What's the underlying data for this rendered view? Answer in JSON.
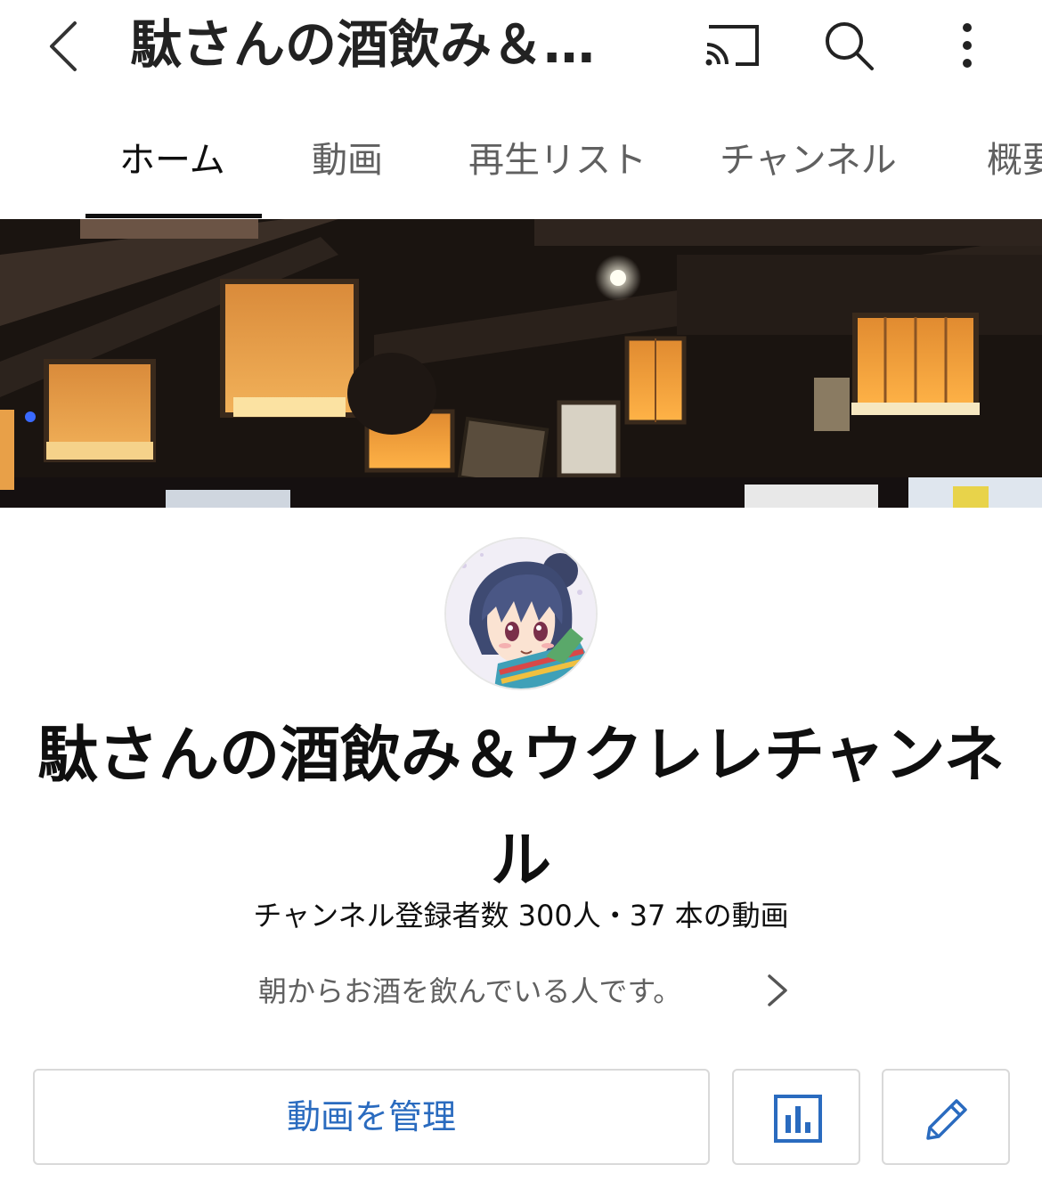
{
  "header": {
    "title": "駄さんの酒飲み＆…",
    "back_icon": "chevron-left-icon",
    "cast_icon": "cast-icon",
    "search_icon": "search-icon",
    "more_icon": "more-vertical-icon"
  },
  "tabs": [
    {
      "label": "ホーム",
      "active": true
    },
    {
      "label": "動画",
      "active": false
    },
    {
      "label": "再生リスト",
      "active": false
    },
    {
      "label": "チャンネル",
      "active": false
    },
    {
      "label": "概要",
      "active": false
    }
  ],
  "channel": {
    "name": "駄さんの酒飲み＆ウクレレチャンネル",
    "stats": "チャンネル登録者数 300人・37 本の動画",
    "description": "朝からお酒を飲んでいる人です。"
  },
  "actions": {
    "manage_label": "動画を管理",
    "analytics_icon": "analytics-icon",
    "edit_icon": "pencil-icon"
  },
  "colors": {
    "accent_blue": "#2a6bbf",
    "text_primary": "#0f0f0f",
    "text_secondary": "#606060"
  }
}
